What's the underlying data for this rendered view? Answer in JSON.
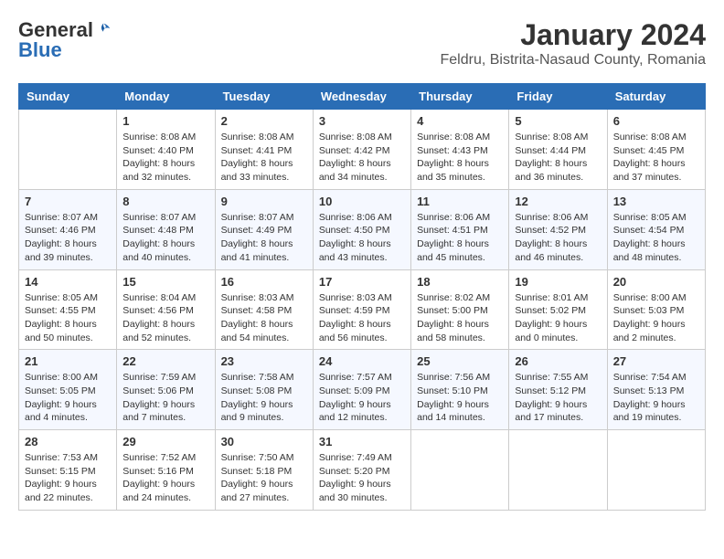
{
  "header": {
    "logo_general": "General",
    "logo_blue": "Blue",
    "month_title": "January 2024",
    "location": "Feldru, Bistrita-Nasaud County, Romania"
  },
  "weekdays": [
    "Sunday",
    "Monday",
    "Tuesday",
    "Wednesday",
    "Thursday",
    "Friday",
    "Saturday"
  ],
  "weeks": [
    [
      {
        "day": "",
        "info": ""
      },
      {
        "day": "1",
        "info": "Sunrise: 8:08 AM\nSunset: 4:40 PM\nDaylight: 8 hours\nand 32 minutes."
      },
      {
        "day": "2",
        "info": "Sunrise: 8:08 AM\nSunset: 4:41 PM\nDaylight: 8 hours\nand 33 minutes."
      },
      {
        "day": "3",
        "info": "Sunrise: 8:08 AM\nSunset: 4:42 PM\nDaylight: 8 hours\nand 34 minutes."
      },
      {
        "day": "4",
        "info": "Sunrise: 8:08 AM\nSunset: 4:43 PM\nDaylight: 8 hours\nand 35 minutes."
      },
      {
        "day": "5",
        "info": "Sunrise: 8:08 AM\nSunset: 4:44 PM\nDaylight: 8 hours\nand 36 minutes."
      },
      {
        "day": "6",
        "info": "Sunrise: 8:08 AM\nSunset: 4:45 PM\nDaylight: 8 hours\nand 37 minutes."
      }
    ],
    [
      {
        "day": "7",
        "info": "Sunrise: 8:07 AM\nSunset: 4:46 PM\nDaylight: 8 hours\nand 39 minutes."
      },
      {
        "day": "8",
        "info": "Sunrise: 8:07 AM\nSunset: 4:48 PM\nDaylight: 8 hours\nand 40 minutes."
      },
      {
        "day": "9",
        "info": "Sunrise: 8:07 AM\nSunset: 4:49 PM\nDaylight: 8 hours\nand 41 minutes."
      },
      {
        "day": "10",
        "info": "Sunrise: 8:06 AM\nSunset: 4:50 PM\nDaylight: 8 hours\nand 43 minutes."
      },
      {
        "day": "11",
        "info": "Sunrise: 8:06 AM\nSunset: 4:51 PM\nDaylight: 8 hours\nand 45 minutes."
      },
      {
        "day": "12",
        "info": "Sunrise: 8:06 AM\nSunset: 4:52 PM\nDaylight: 8 hours\nand 46 minutes."
      },
      {
        "day": "13",
        "info": "Sunrise: 8:05 AM\nSunset: 4:54 PM\nDaylight: 8 hours\nand 48 minutes."
      }
    ],
    [
      {
        "day": "14",
        "info": "Sunrise: 8:05 AM\nSunset: 4:55 PM\nDaylight: 8 hours\nand 50 minutes."
      },
      {
        "day": "15",
        "info": "Sunrise: 8:04 AM\nSunset: 4:56 PM\nDaylight: 8 hours\nand 52 minutes."
      },
      {
        "day": "16",
        "info": "Sunrise: 8:03 AM\nSunset: 4:58 PM\nDaylight: 8 hours\nand 54 minutes."
      },
      {
        "day": "17",
        "info": "Sunrise: 8:03 AM\nSunset: 4:59 PM\nDaylight: 8 hours\nand 56 minutes."
      },
      {
        "day": "18",
        "info": "Sunrise: 8:02 AM\nSunset: 5:00 PM\nDaylight: 8 hours\nand 58 minutes."
      },
      {
        "day": "19",
        "info": "Sunrise: 8:01 AM\nSunset: 5:02 PM\nDaylight: 9 hours\nand 0 minutes."
      },
      {
        "day": "20",
        "info": "Sunrise: 8:00 AM\nSunset: 5:03 PM\nDaylight: 9 hours\nand 2 minutes."
      }
    ],
    [
      {
        "day": "21",
        "info": "Sunrise: 8:00 AM\nSunset: 5:05 PM\nDaylight: 9 hours\nand 4 minutes."
      },
      {
        "day": "22",
        "info": "Sunrise: 7:59 AM\nSunset: 5:06 PM\nDaylight: 9 hours\nand 7 minutes."
      },
      {
        "day": "23",
        "info": "Sunrise: 7:58 AM\nSunset: 5:08 PM\nDaylight: 9 hours\nand 9 minutes."
      },
      {
        "day": "24",
        "info": "Sunrise: 7:57 AM\nSunset: 5:09 PM\nDaylight: 9 hours\nand 12 minutes."
      },
      {
        "day": "25",
        "info": "Sunrise: 7:56 AM\nSunset: 5:10 PM\nDaylight: 9 hours\nand 14 minutes."
      },
      {
        "day": "26",
        "info": "Sunrise: 7:55 AM\nSunset: 5:12 PM\nDaylight: 9 hours\nand 17 minutes."
      },
      {
        "day": "27",
        "info": "Sunrise: 7:54 AM\nSunset: 5:13 PM\nDaylight: 9 hours\nand 19 minutes."
      }
    ],
    [
      {
        "day": "28",
        "info": "Sunrise: 7:53 AM\nSunset: 5:15 PM\nDaylight: 9 hours\nand 22 minutes."
      },
      {
        "day": "29",
        "info": "Sunrise: 7:52 AM\nSunset: 5:16 PM\nDaylight: 9 hours\nand 24 minutes."
      },
      {
        "day": "30",
        "info": "Sunrise: 7:50 AM\nSunset: 5:18 PM\nDaylight: 9 hours\nand 27 minutes."
      },
      {
        "day": "31",
        "info": "Sunrise: 7:49 AM\nSunset: 5:20 PM\nDaylight: 9 hours\nand 30 minutes."
      },
      {
        "day": "",
        "info": ""
      },
      {
        "day": "",
        "info": ""
      },
      {
        "day": "",
        "info": ""
      }
    ]
  ]
}
